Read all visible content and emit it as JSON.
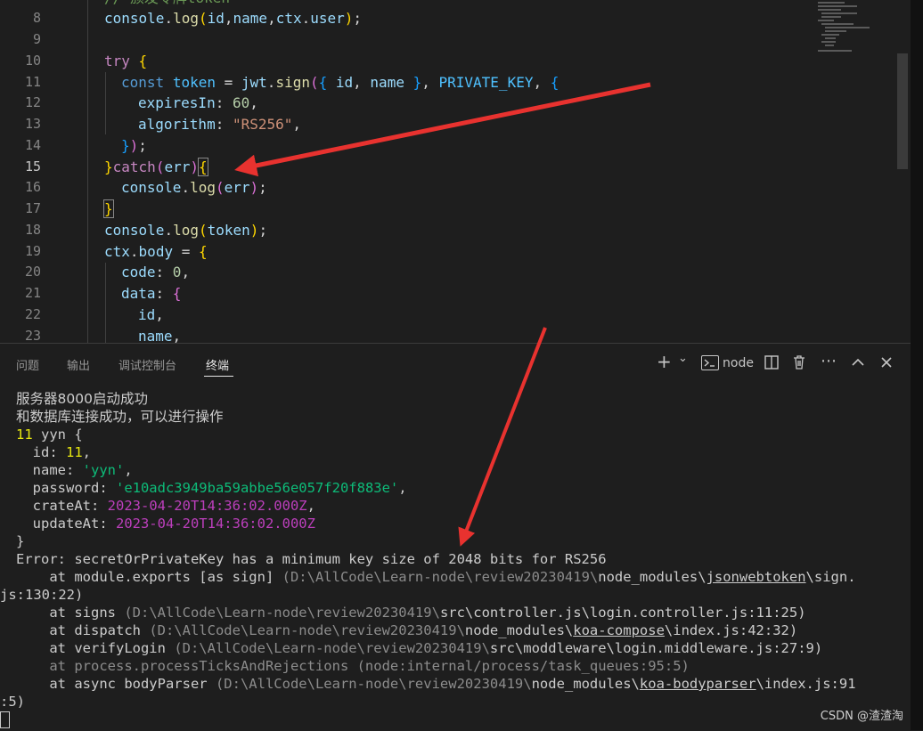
{
  "editor": {
    "line_numbers": [
      "8",
      "9",
      "10",
      "11",
      "12",
      "13",
      "14",
      "15",
      "16",
      "17",
      "18",
      "19",
      "20",
      "21",
      "22",
      "23"
    ],
    "active_line": "15",
    "top_comment": "// 颁发令牌token",
    "code": {
      "l8": {
        "a": "console",
        "b": ".",
        "c": "log",
        "d": "(",
        "e": "id",
        "f": ",",
        "g": "name",
        "h": ",",
        "i": "ctx",
        "j": ".",
        "k": "user",
        "l": ")",
        "m": ";"
      },
      "l10": {
        "a": "try",
        "b": " ",
        "c": "{"
      },
      "l11": {
        "a": "const",
        "b": " ",
        "c": "token",
        "d": " = ",
        "e": "jwt",
        "f": ".",
        "g": "sign",
        "h": "(",
        "i": "{",
        "j": " ",
        "k": "id",
        "l": ", ",
        "m": "name",
        "n": " ",
        "o": "}",
        "p": ", ",
        "q": "PRIVATE_KEY",
        "r": ", ",
        "s": "{"
      },
      "l12": {
        "a": "expiresIn",
        "b": ": ",
        "c": "60",
        "d": ","
      },
      "l13": {
        "a": "algorithm",
        "b": ": ",
        "c": "\"RS256\"",
        "d": ","
      },
      "l14": {
        "a": "}",
        "b": ")",
        "c": ";"
      },
      "l15": {
        "a": "}",
        "b": "catch",
        "c": "(",
        "d": "err",
        "e": ")",
        "f": "{"
      },
      "l16": {
        "a": "console",
        "b": ".",
        "c": "log",
        "d": "(",
        "e": "err",
        "f": ")",
        "g": ";"
      },
      "l17": {
        "a": "}"
      },
      "l18": {
        "a": "console",
        "b": ".",
        "c": "log",
        "d": "(",
        "e": "token",
        "f": ")",
        "g": ";"
      },
      "l19": {
        "a": "ctx",
        "b": ".",
        "c": "body",
        "d": " = ",
        "e": "{"
      },
      "l20": {
        "a": "code",
        "b": ": ",
        "c": "0",
        "d": ","
      },
      "l21": {
        "a": "data",
        "b": ": ",
        "c": "{"
      },
      "l22": {
        "a": "id",
        "b": ","
      },
      "l23": {
        "a": "name",
        "b": ","
      }
    }
  },
  "panel": {
    "tabs": [
      "问题",
      "输出",
      "调试控制台",
      "终端"
    ],
    "active_tab": "终端",
    "toolbar": {
      "add": "+",
      "add_dropdown": "⌄",
      "shell": "node",
      "split": "◫",
      "trash": "🗑",
      "more": "⋯",
      "maximize": "^",
      "close": "✕"
    }
  },
  "terminal": {
    "l1": "服务器8000启动成功",
    "l2": "和数据库连接成功，可以进行操作",
    "l3": {
      "num": "11",
      "rest": " yyn {"
    },
    "l4": {
      "key": "  id: ",
      "val": "11",
      "end": ","
    },
    "l5": {
      "key": "  name: ",
      "val": "'yyn'",
      "end": ","
    },
    "l6": {
      "key": "  password: ",
      "val": "'e10adc3949ba59abbe56e057f20f883e'",
      "end": ","
    },
    "l7": {
      "key": "  crateAt: ",
      "val": "2023-04-20T14:36:02.000Z",
      "end": ","
    },
    "l8": {
      "key": "  updateAt: ",
      "val": "2023-04-20T14:36:02.000Z",
      "end": ""
    },
    "l9": "}",
    "l10": "Error: secretOrPrivateKey has a minimum key size of 2048 bits for RS256",
    "l11": {
      "a": "    at module.exports [as sign] ",
      "b": "(D:\\AllCode\\Learn-node\\review20230419\\",
      "c": "node_modules\\",
      "d": "jsonwebtoken",
      "e": "\\sign."
    },
    "l12": "js:130:22)",
    "l13": {
      "a": "    at signs ",
      "b": "(D:\\AllCode\\Learn-node\\review20230419\\",
      "c": "src\\controller.js\\login.controller.js:11:25)"
    },
    "l14": {
      "a": "    at dispatch ",
      "b": "(D:\\AllCode\\Learn-node\\review20230419\\",
      "c": "node_modules\\",
      "d": "koa-compose",
      "e": "\\index.js:42:32)"
    },
    "l15": {
      "a": "    at verifyLogin ",
      "b": "(D:\\AllCode\\Learn-node\\review20230419\\",
      "c": "src\\moddleware\\login.middleware.js:27:9)"
    },
    "l16": "    at process.processTicksAndRejections (node:internal/process/task_queues:95:5)",
    "l17": {
      "a": "    at async bodyParser ",
      "b": "(D:\\AllCode\\Learn-node\\review20230419\\",
      "c": "node_modules\\",
      "d": "koa-bodyparser",
      "e": "\\index.js:91"
    },
    "l18": ":5)"
  },
  "watermark": "CSDN @渣渣淘",
  "colors": {
    "arrow": "#e8322f",
    "background": "#1e1e1e"
  }
}
